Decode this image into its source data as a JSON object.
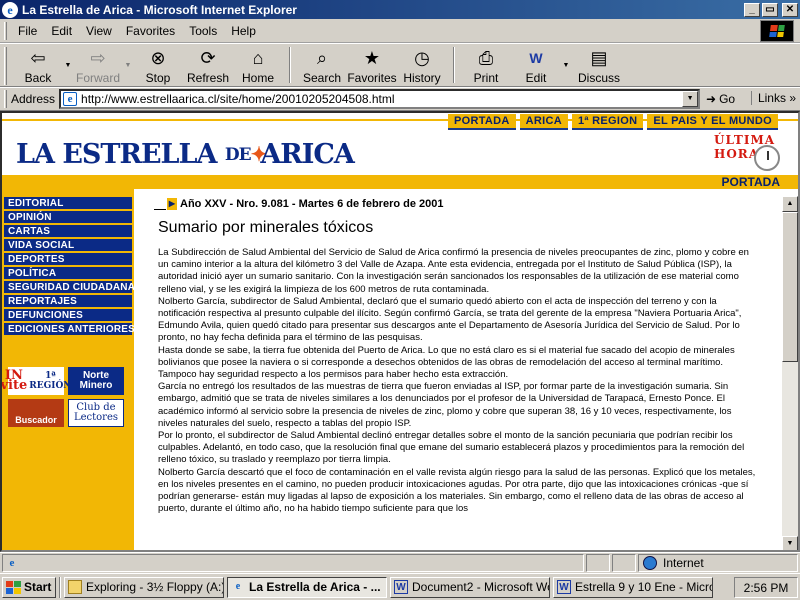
{
  "window": {
    "title": "La Estrella de Arica - Microsoft Internet Explorer",
    "buttons": {
      "minimize": "_",
      "maximize": "▭",
      "close": "✕"
    }
  },
  "menu": [
    "File",
    "Edit",
    "View",
    "Favorites",
    "Tools",
    "Help"
  ],
  "toolbar": {
    "back": "Back",
    "forward": "Forward",
    "stop": "Stop",
    "refresh": "Refresh",
    "home": "Home",
    "search": "Search",
    "favorites": "Favorites",
    "history": "History",
    "print": "Print",
    "edit": "Edit",
    "discuss": "Discuss"
  },
  "address": {
    "label": "Address",
    "url": "http://www.estrellaarica.cl/site/home/20010205204508.html",
    "go": "Go",
    "links": "Links"
  },
  "site": {
    "nav_tabs": [
      "PORTADA",
      "ARICA",
      "1ª REGION",
      "EL PAIS Y EL MUNDO"
    ],
    "logo_word1": "LA ESTRELLA",
    "logo_word2": "DE",
    "logo_word3": "ARICA",
    "ultima_line1": "ÚLTIMA",
    "ultima_line2": "HORA",
    "portada": "PORTADA",
    "sections": [
      "EDITORIAL",
      "OPINIÓN",
      "CARTAS",
      "VIDA SOCIAL",
      "DEPORTES",
      "POLÍTICA",
      "SEGURIDAD CIUDADANA",
      "REPORTAJES",
      "DEFUNCIONES",
      "EDICIONES ANTERIORES"
    ],
    "ads": {
      "invite": "IN vite",
      "invite_sub": "1ª REGIÓN",
      "norte": "Norte Minero",
      "buscador": "Buscador",
      "club": "Club de Lectores"
    }
  },
  "article": {
    "issue": "Año XXV - Nro. 9.081 - Martes 6 de febrero de 2001",
    "headline": "Sumario por minerales tóxicos",
    "paragraphs": [
      "La Subdirección de Salud Ambiental del Servicio de Salud de Arica confirmó la presencia de niveles preocupantes de zinc, plomo y cobre en un camino interior a la altura del kilómetro 3 del Valle de Azapa. Ante esta evidencia, entregada por el Instituto de Salud Pública (ISP), la autoridad inició ayer un sumario sanitario. Con la investigación serán sancionados los responsables de la utilización de ese material como relleno vial, y se les exigirá la limpieza de los 600 metros de ruta contaminada.",
      "Nolberto García, subdirector de Salud Ambiental, declaró que el sumario quedó abierto con el acta de inspección del terreno y con la notificación respectiva al presunto culpable del ilícito. Según confirmó García, se trata del gerente de la empresa \"Naviera Portuaria Arica\", Edmundo Avila, quien quedó citado para presentar sus descargos ante el Departamento de Asesoría Jurídica del Servicio de Salud. Por lo pronto, no hay fecha definida para el término de las pesquisas.",
      "Hasta donde se sabe, la tierra fue obtenida del Puerto de Arica. Lo que no está claro es si el material fue sacado del acopio de minerales bolivianos que posee la naviera o si corresponde a desechos obtenidos de las obras de remodelación del acceso al terminal marítimo. Tampoco hay seguridad respecto a los permisos para haber hecho esta extracción.",
      "García no entregó los resultados de las muestras de tierra que fueron enviadas al ISP, por formar parte de la investigación sumaria. Sin embargo, admitió que se trata de niveles similares a los denunciados por el profesor de la Universidad de Tarapacá, Ernesto Ponce. El académico informó al servicio sobre la presencia de niveles de zinc, plomo y cobre que superan 38, 16 y 10 veces, respectivamente, los niveles naturales del suelo, respecto a tablas del propio ISP.",
      "Por lo pronto, el subdirector de Salud Ambiental declinó entregar detalles sobre el monto de la sanción pecuniaria que podrían recibir los culpables. Adelantó, en todo caso, que la resolución final que emane del sumario establecerá plazos y procedimientos para la remoción del relleno tóxico, su traslado y reemplazo por tierra limpia.",
      "Nolberto García descartó que el foco de contaminación en el valle revista algún riesgo para la salud de las personas. Explicó que los metales, en los niveles presentes en el camino, no pueden producir intoxicaciones agudas. Por otra parte, dijo que las intoxicaciones crónicas -que sí podrían generarse- están muy ligadas al lapso de exposición a los materiales. Sin embargo, como el relleno data de las obras de acceso al puerto, durante el último año, no ha habido tiempo suficiente para que los"
    ]
  },
  "status": {
    "zone": "Internet"
  },
  "taskbar": {
    "start": "Start",
    "tasks": [
      {
        "label": "Exploring - 3½ Floppy (A:)",
        "icon": "folder-icon",
        "active": false
      },
      {
        "label": "La Estrella de Arica - ...",
        "icon": "ie-icon",
        "active": true
      },
      {
        "label": "Document2 - Microsoft Word",
        "icon": "word-icon",
        "active": false
      },
      {
        "label": "Estrella 9 y 10 Ene - Micro...",
        "icon": "word-icon",
        "active": false
      }
    ],
    "clock": "2:56 PM"
  }
}
